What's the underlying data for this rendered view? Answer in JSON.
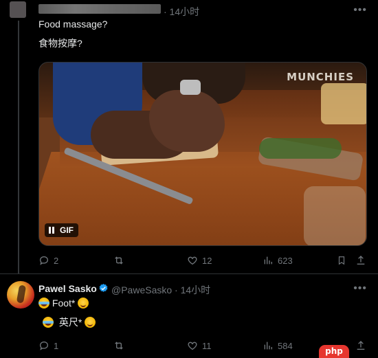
{
  "tweet1": {
    "time": "· 14小时",
    "text_en": "Food massage?",
    "text_zh": "食物按摩?",
    "media": {
      "watermark": "MUNCHIES",
      "gif_label": "GIF"
    },
    "stats": {
      "replies": "2",
      "likes": "12",
      "views": "623"
    }
  },
  "tweet2": {
    "author_name": "Pawel Sasko",
    "handle_time": "@PaweSasko · 14小时",
    "text_en": "Foot*",
    "text_zh": "英尺*",
    "stats": {
      "replies": "1",
      "likes": "11",
      "views": "584"
    }
  },
  "watermark_logo": "php"
}
